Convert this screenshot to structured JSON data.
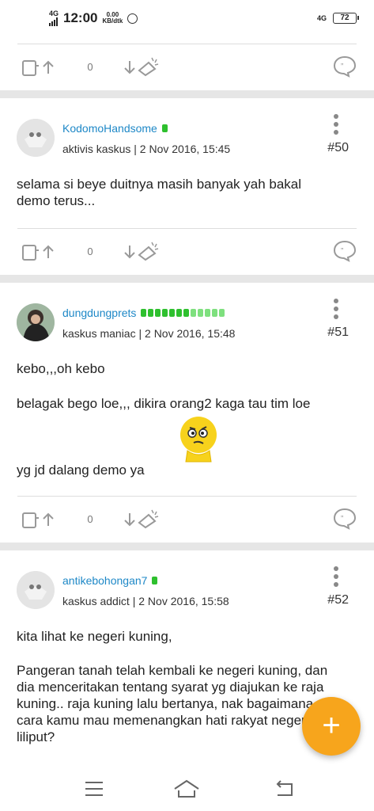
{
  "status_bar": {
    "network": "4G",
    "time": "12:00",
    "speed_value": "0.00",
    "speed_unit": "KB/dtk",
    "network_right": "4G",
    "battery": "72"
  },
  "top_actions": {
    "vote_count": "0"
  },
  "posts": [
    {
      "username": "KodomoHandsome",
      "rank": "aktivis kaskus",
      "datetime": "2 Nov 2016, 15:45",
      "number": "#50",
      "lines": [
        "selama si beye duitnya masih banyak yah bakal",
        "demo terus..."
      ],
      "vote_count": "0",
      "reputation_bars": 1
    },
    {
      "username": "dungdungprets",
      "rank": "kaskus maniac",
      "datetime": "2 Nov 2016, 15:48",
      "number": "#51",
      "lines": [
        "kebo,,,oh kebo",
        "belagak bego loe,,, dikira orang2 kaga tau tim loe",
        "yg jd dalang demo ya"
      ],
      "vote_count": "0",
      "reputation_bars": 12
    },
    {
      "username": "antikebohongan7",
      "rank": "kaskus addict",
      "datetime": "2 Nov 2016, 15:58",
      "number": "#52",
      "lines": [
        "kita lihat ke negeri kuning,",
        "Pangeran tanah telah kembali ke negeri kuning, dan",
        "dia menceritakan tentang syarat yg diajukan ke raja",
        "kuning.. raja kuning lalu bertanya, nak bagaimana",
        "cara kamu mau memenangkan hati rakyat negeri",
        "liliput?"
      ],
      "reputation_bars": 1
    }
  ],
  "fab": {
    "label": "+"
  },
  "colors": {
    "accent": "#f7a51c",
    "username": "#1e88c7",
    "reputation": "#2ec02e"
  },
  "icons": [
    "vote-up-icon",
    "vote-down-icon",
    "reply-icon",
    "more-vert-icon",
    "menu-icon",
    "home-icon",
    "back-icon"
  ]
}
